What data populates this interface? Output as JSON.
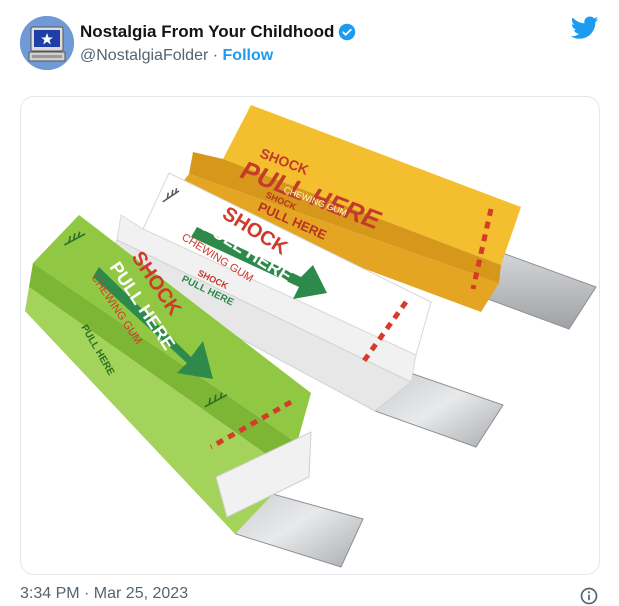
{
  "author": {
    "display_name": "Nostalgia From Your Childhood",
    "handle": "@NostalgiaFolder",
    "separator": "·",
    "follow_label": "Follow",
    "verified": true
  },
  "media": {
    "packs": [
      {
        "color": "#f0b323",
        "brand": "SHOCK",
        "main_label": "PULL HERE",
        "sub_label": "CHEWING GUM",
        "side_brand": "SHOCK",
        "side_label": "PULL HERE"
      },
      {
        "color": "#ffffff",
        "brand": "SHOCK",
        "main_label": "PULL HERE",
        "sub_label": "CHEWING GUM",
        "side_brand": "SHOCK",
        "side_label": "PULL HERE"
      },
      {
        "color": "#8cc63f",
        "brand": "SHOCK",
        "main_label": "PULL HERE",
        "sub_label": "CHEWING GUM",
        "side_label": "PULL HERE"
      }
    ]
  },
  "footer": {
    "timestamp": "3:34 PM · Mar 25, 2023"
  },
  "colors": {
    "accent": "#1d9bf0",
    "text_secondary": "#536471"
  },
  "icons": [
    "verified-badge-icon",
    "twitter-bird-icon",
    "info-icon"
  ]
}
